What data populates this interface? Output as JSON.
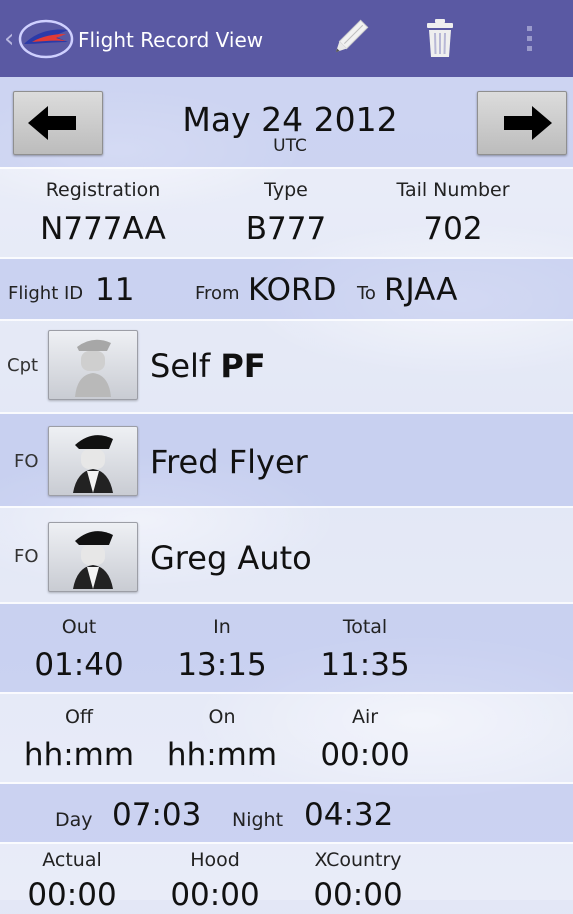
{
  "app_bar": {
    "title": "Flight Record View",
    "icons": [
      "back-chevron",
      "app-logo",
      "pencil-edit",
      "trash-delete",
      "overflow-menu"
    ]
  },
  "date_nav": {
    "prev_icon": "left-arrow",
    "next_icon": "right-arrow",
    "date": "May 24 2012",
    "timezone": "UTC"
  },
  "aircraft": {
    "registration_label": "Registration",
    "registration": "N777AA",
    "type_label": "Type",
    "type": "B777",
    "tail_label": "Tail Number",
    "tail": "702"
  },
  "route": {
    "flight_id_label": "Flight ID",
    "flight_id": "11",
    "from_label": "From",
    "from": "KORD",
    "to_label": "To",
    "to": "RJAA"
  },
  "crew": [
    {
      "role": "Cpt",
      "name": "Self",
      "duty": "PF"
    },
    {
      "role": "FO",
      "name": "Fred Flyer",
      "duty": ""
    },
    {
      "role": "FO",
      "name": "Greg Auto",
      "duty": ""
    }
  ],
  "block_times": {
    "out_label": "Out",
    "out": "01:40",
    "in_label": "In",
    "in": "13:15",
    "total_label": "Total",
    "total": "11:35"
  },
  "air_times": {
    "off_label": "Off",
    "off": "hh:mm",
    "on_label": "On",
    "on": "hh:mm",
    "air_label": "Air",
    "air": "00:00"
  },
  "day_night": {
    "day_label": "Day",
    "day": "07:03",
    "night_label": "Night",
    "night": "04:32"
  },
  "conditions": {
    "actual_label": "Actual",
    "actual": "00:00",
    "hood_label": "Hood",
    "hood": "00:00",
    "xcountry_label": "XCountry",
    "xcountry": "00:00"
  },
  "colors": {
    "action_bar": "#5a59a3",
    "band": "#c3caef"
  }
}
